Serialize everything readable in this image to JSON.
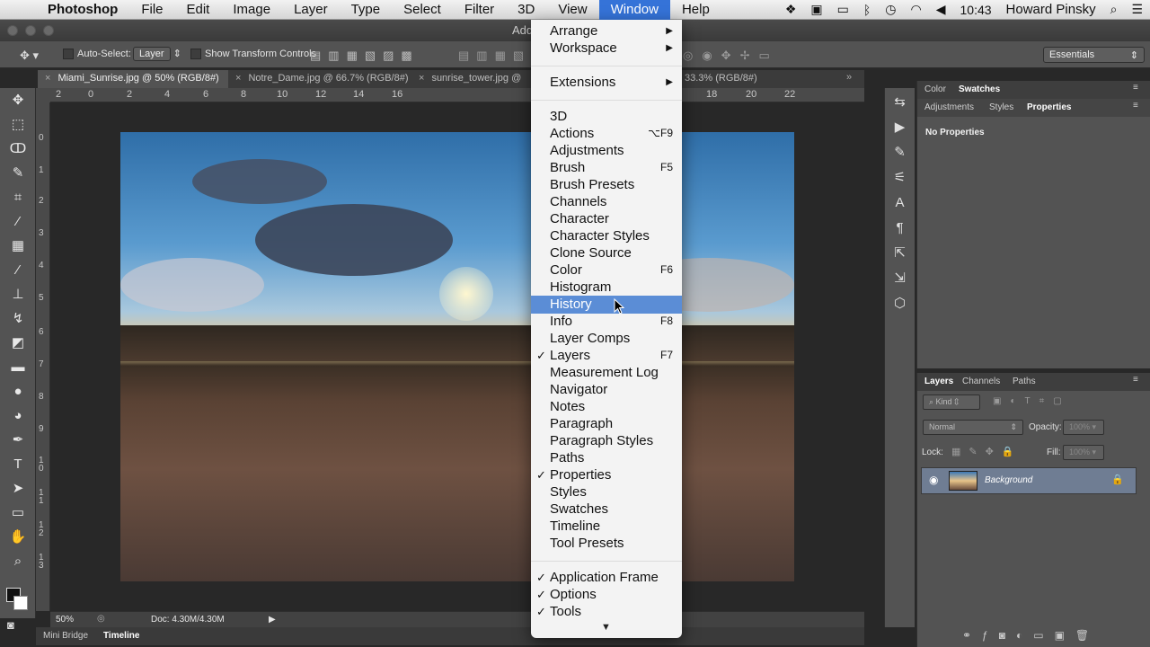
{
  "menubar": {
    "app_name": "Photoshop",
    "items": [
      "File",
      "Edit",
      "Image",
      "Layer",
      "Type",
      "Select",
      "Filter",
      "3D",
      "View",
      "Window",
      "Help"
    ],
    "active_item": "Window",
    "clock": "10:43",
    "user": "Howard Pinsky"
  },
  "titlebar": {
    "title": "Add"
  },
  "options": {
    "auto_select_label": "Auto-Select:",
    "auto_select_value": "Layer",
    "transform_label": "Show Transform Controls",
    "workspace": "Essentials"
  },
  "tabs": [
    {
      "label": "Miami_Sunrise.jpg @ 50% (RGB/8#)",
      "active": true
    },
    {
      "label": "Notre_Dame.jpg @ 66.7% (RGB/8#)",
      "active": false
    },
    {
      "label": "sunrise_tower.jpg @",
      "active": false
    },
    {
      "label": "33.3% (RGB/8#)",
      "active": false
    }
  ],
  "ruler_top": [
    "2",
    "0",
    "2",
    "4",
    "6",
    "8",
    "10",
    "12",
    "14",
    "16",
    "18",
    "20",
    "22"
  ],
  "ruler_left": [
    "0",
    "1",
    "2",
    "3",
    "4",
    "5",
    "6",
    "7",
    "8",
    "9",
    "1 0",
    "1 1",
    "1 2",
    "1 3"
  ],
  "status": {
    "zoom": "50%",
    "doc": "Doc: 4.30M/4.30M"
  },
  "bottom_tabs": [
    "Mini Bridge",
    "Timeline"
  ],
  "panels": {
    "color_tabs": [
      "Color",
      "Swatches"
    ],
    "props_tabs": [
      "Adjustments",
      "Styles",
      "Properties"
    ],
    "no_props": "No Properties",
    "layers_tabs": [
      "Layers",
      "Channels",
      "Paths"
    ],
    "kind_label": "Kind",
    "blend_mode": "Normal",
    "opacity_label": "Opacity:",
    "opacity_value": "100%",
    "lock_label": "Lock:",
    "fill_label": "Fill:",
    "fill_value": "100%",
    "layer_name": "Background"
  },
  "window_menu": {
    "group1": [
      {
        "label": "Arrange",
        "submenu": true
      },
      {
        "label": "Workspace",
        "submenu": true
      }
    ],
    "group2": [
      {
        "label": "Extensions",
        "submenu": true
      }
    ],
    "group3": [
      {
        "label": "3D",
        "shortcut": ""
      },
      {
        "label": "Actions",
        "shortcut": "⌥F9"
      },
      {
        "label": "Adjustments",
        "shortcut": ""
      },
      {
        "label": "Brush",
        "shortcut": "F5"
      },
      {
        "label": "Brush Presets",
        "shortcut": ""
      },
      {
        "label": "Channels",
        "shortcut": ""
      },
      {
        "label": "Character",
        "shortcut": ""
      },
      {
        "label": "Character Styles",
        "shortcut": ""
      },
      {
        "label": "Clone Source",
        "shortcut": ""
      },
      {
        "label": "Color",
        "shortcut": "F6"
      },
      {
        "label": "Histogram",
        "shortcut": ""
      },
      {
        "label": "History",
        "shortcut": "",
        "highlighted": true
      },
      {
        "label": "Info",
        "shortcut": "F8"
      },
      {
        "label": "Layer Comps",
        "shortcut": ""
      },
      {
        "label": "Layers",
        "shortcut": "F7",
        "checked": true
      },
      {
        "label": "Measurement Log",
        "shortcut": ""
      },
      {
        "label": "Navigator",
        "shortcut": ""
      },
      {
        "label": "Notes",
        "shortcut": ""
      },
      {
        "label": "Paragraph",
        "shortcut": ""
      },
      {
        "label": "Paragraph Styles",
        "shortcut": ""
      },
      {
        "label": "Paths",
        "shortcut": ""
      },
      {
        "label": "Properties",
        "shortcut": "",
        "checked": true
      },
      {
        "label": "Styles",
        "shortcut": ""
      },
      {
        "label": "Swatches",
        "shortcut": ""
      },
      {
        "label": "Timeline",
        "shortcut": ""
      },
      {
        "label": "Tool Presets",
        "shortcut": ""
      }
    ],
    "group4": [
      {
        "label": "Application Frame",
        "checked": true
      },
      {
        "label": "Options",
        "checked": true
      },
      {
        "label": "Tools",
        "checked": true
      }
    ]
  }
}
